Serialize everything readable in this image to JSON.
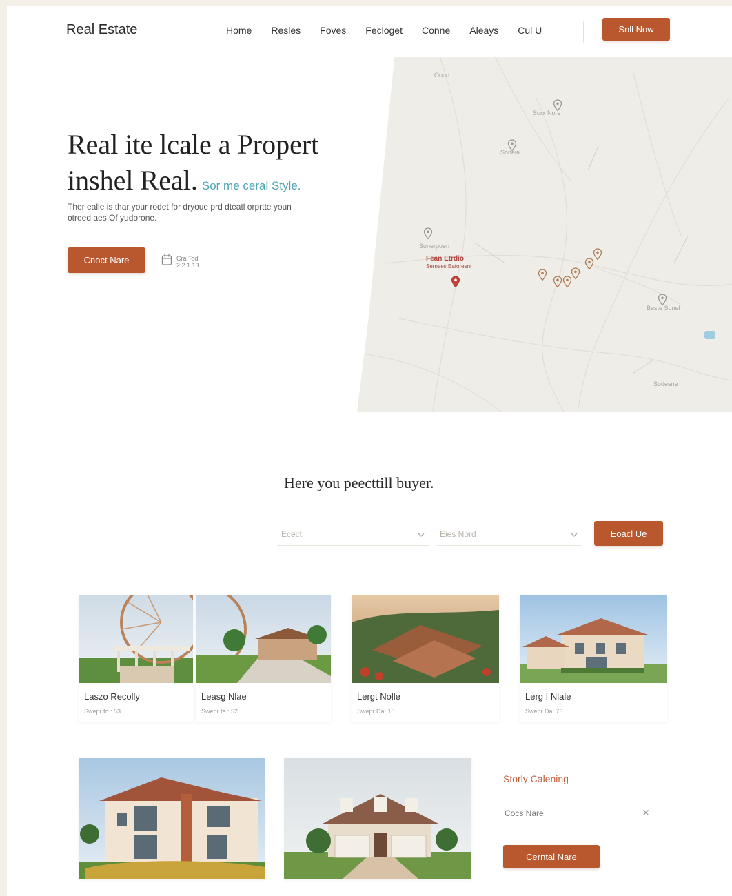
{
  "brand": {
    "name": "Real Estate",
    "accent": "#b9582f"
  },
  "nav": {
    "items": [
      "Home",
      "Resles",
      "Foves",
      "Fecloget",
      "Conne",
      "Aleays",
      "Cul U"
    ],
    "cta": "Snll Now"
  },
  "hero": {
    "title_line1": "Real ite lcale a Propert",
    "title_line2": "inshel Real.",
    "title_accent": "Sor me ceral Style.",
    "description": "Ther ealle is thar your rodet for dryoue prd dteatl orprtte youn otreed aes Of yudorone.",
    "button": "Cnoct Nare",
    "meta_line1": "Cra Tod",
    "meta_line2": "2.2 1 13"
  },
  "map": {
    "center_label_1": "Fean Etrdio",
    "center_label_2": "Sernees Eatoresnt"
  },
  "search": {
    "title": "Here you peecttill buyer.",
    "select_1_placeholder": "Ecect",
    "select_2_placeholder": "Eies Nord",
    "button": "Eoacl Ue"
  },
  "listings": [
    {
      "name": "Laszo Recolly",
      "sub": "Swepr fo : 53"
    },
    {
      "name": "Leasg Nlae",
      "sub": "Swepr fe : 52"
    },
    {
      "name": "Lergt Nolle",
      "sub": "Swepr Da: 10"
    },
    {
      "name": "Lerg I Nlale",
      "sub": "Swepr Da: 73"
    }
  ],
  "sidebar": {
    "title": "Storly Calening",
    "input_value": "Cocs Nare",
    "button": "Cerntal Nare"
  },
  "icons": [
    "pin-icon",
    "chevron-down-icon",
    "close-icon",
    "calendar-icon"
  ]
}
